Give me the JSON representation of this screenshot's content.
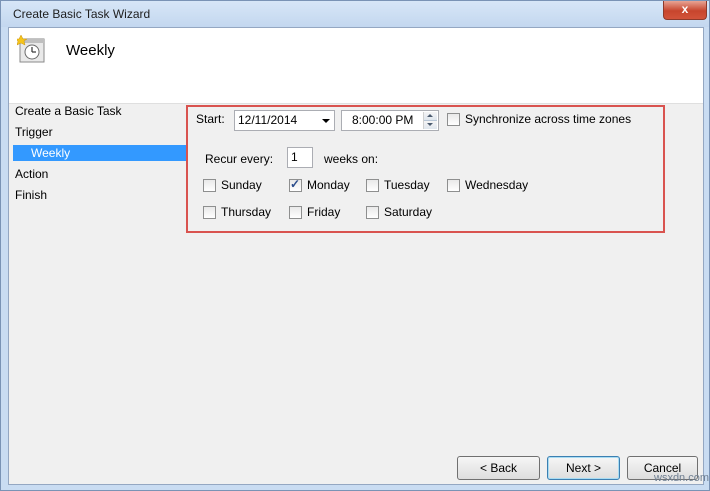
{
  "window": {
    "title": "Create Basic Task Wizard",
    "close_glyph": "x"
  },
  "header": {
    "title": "Weekly",
    "icon": "task-scheduler-clock-icon"
  },
  "nav": {
    "items": [
      {
        "label": "Create a Basic Task"
      },
      {
        "label": "Trigger"
      },
      {
        "label": "Weekly",
        "selected": true
      },
      {
        "label": "Action"
      },
      {
        "label": "Finish"
      }
    ]
  },
  "form": {
    "start_label": "Start:",
    "start_date": "12/11/2014",
    "start_time": "8:00:00 PM",
    "sync_label": "Synchronize across time zones",
    "sync_checked": false,
    "recur_label": "Recur every:",
    "recur_value": "1",
    "weeks_on_label": "weeks on:",
    "days": [
      {
        "label": "Sunday",
        "checked": false
      },
      {
        "label": "Monday",
        "checked": true
      },
      {
        "label": "Tuesday",
        "checked": false
      },
      {
        "label": "Wednesday",
        "checked": false
      },
      {
        "label": "Thursday",
        "checked": false
      },
      {
        "label": "Friday",
        "checked": false
      },
      {
        "label": "Saturday",
        "checked": false
      }
    ]
  },
  "buttons": {
    "back": "< Back",
    "next": "Next >",
    "cancel": "Cancel"
  },
  "watermark": "wsxdn.com",
  "colors": {
    "highlight_frame": "#d9534f",
    "selection": "#3399ff"
  }
}
